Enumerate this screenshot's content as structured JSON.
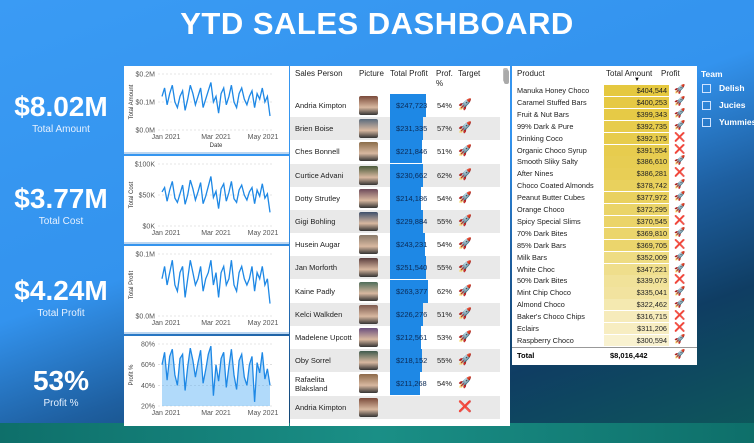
{
  "title": "YTD SALES DASHBOARD",
  "kpis": [
    {
      "value": "$8.02M",
      "label": "Total Amount"
    },
    {
      "value": "$3.77M",
      "label": "Total Cost"
    },
    {
      "value": "$4.24M",
      "label": "Total Profit"
    },
    {
      "value": "53%",
      "label": "Profit %"
    }
  ],
  "colors": {
    "accent": "#1e88e5",
    "line": "#1e88e5",
    "header_bg": "#3a9bf4",
    "gold": "#e2c22a",
    "light_gold": "#f7efb8"
  },
  "chart_data": [
    {
      "type": "line",
      "ylabel": "Total Amount",
      "xlabel": "Date",
      "ticks_y": [
        "$0.2M",
        "$0.1M",
        "$0.0M"
      ],
      "ticks_x": [
        "Jan 2021",
        "Mar 2021",
        "May 2021"
      ],
      "ylim": [
        0,
        0.2
      ],
      "values": [
        0.12,
        0.15,
        0.09,
        0.13,
        0.16,
        0.1,
        0.08,
        0.12,
        0.14,
        0.07,
        0.11,
        0.16,
        0.13,
        0.09,
        0.12,
        0.15,
        0.08,
        0.11,
        0.14,
        0.17,
        0.1,
        0.12,
        0.06,
        0.13,
        0.15,
        0.09,
        0.12,
        0.16,
        0.1,
        0.08,
        0.13,
        0.15,
        0.11,
        0.09,
        0.12,
        0.14,
        0.08,
        0.13,
        0.11,
        0.15,
        0.1,
        0.12,
        0.05
      ]
    },
    {
      "type": "line",
      "ylabel": "Total Cost",
      "ticks_y": [
        "$100K",
        "$50K",
        "$0K"
      ],
      "ticks_x": [
        "Jan 2021",
        "Mar 2021",
        "May 2021"
      ],
      "ylim": [
        0,
        100
      ],
      "values": [
        55,
        62,
        40,
        58,
        72,
        45,
        38,
        52,
        66,
        35,
        50,
        74,
        60,
        42,
        55,
        70,
        36,
        48,
        64,
        80,
        46,
        56,
        28,
        60,
        68,
        40,
        54,
        72,
        44,
        38,
        58,
        66,
        50,
        42,
        55,
        62,
        36,
        58,
        48,
        68,
        45,
        52,
        22
      ]
    },
    {
      "type": "line",
      "ylabel": "Total Profit",
      "ticks_y": [
        "$0.1M",
        "$0.0M"
      ],
      "ticks_x": [
        "Jan 2021",
        "Mar 2021",
        "May 2021"
      ],
      "ylim": [
        0,
        0.1
      ],
      "values": [
        0.06,
        0.08,
        0.05,
        0.07,
        0.09,
        0.05,
        0.04,
        0.07,
        0.08,
        0.03,
        0.06,
        0.09,
        0.07,
        0.05,
        0.06,
        0.08,
        0.04,
        0.06,
        0.07,
        0.09,
        0.05,
        0.07,
        0.03,
        0.07,
        0.08,
        0.05,
        0.06,
        0.09,
        0.05,
        0.04,
        0.07,
        0.08,
        0.06,
        0.05,
        0.06,
        0.08,
        0.04,
        0.07,
        0.06,
        0.08,
        0.05,
        0.06,
        0.02
      ]
    },
    {
      "type": "area",
      "ylabel": "Profit %",
      "ticks_y": [
        "80%",
        "60%",
        "40%",
        "20%"
      ],
      "ticks_x": [
        "Jan 2021",
        "Mar 2021",
        "May 2021"
      ],
      "ylim": [
        20,
        80
      ],
      "values": [
        60,
        72,
        45,
        68,
        75,
        50,
        40,
        66,
        70,
        35,
        58,
        76,
        64,
        48,
        62,
        74,
        42,
        55,
        70,
        78,
        30,
        60,
        44,
        66,
        72,
        38,
        58,
        75,
        50,
        36,
        64,
        70,
        48,
        40,
        60,
        68,
        24,
        62,
        52,
        72,
        46,
        56,
        40
      ]
    }
  ],
  "sales_table": {
    "headers": {
      "person": "Sales Person",
      "picture": "Picture",
      "profit": "Total Profit",
      "pct": "Prof. %",
      "target": "Target"
    },
    "rows": [
      {
        "name": "Andria Kimpton",
        "profit": "$247,723",
        "pct": "54%",
        "target": "rocket",
        "fill": 0.94
      },
      {
        "name": "Brien Boise",
        "profit": "$231,335",
        "pct": "57%",
        "target": "rocket",
        "fill": 0.88
      },
      {
        "name": "Ches Bonnell",
        "profit": "$221,846",
        "pct": "51%",
        "target": "rocket",
        "fill": 0.84
      },
      {
        "name": "Curtice Advani",
        "profit": "$230,662",
        "pct": "62%",
        "target": "rocket",
        "fill": 0.87
      },
      {
        "name": "Dotty Strutley",
        "profit": "$214,186",
        "pct": "54%",
        "target": "rocket",
        "fill": 0.81
      },
      {
        "name": "Gigi Bohling",
        "profit": "$229,884",
        "pct": "55%",
        "target": "rocket",
        "fill": 0.87
      },
      {
        "name": "Husein Augar",
        "profit": "$243,231",
        "pct": "54%",
        "target": "rocket",
        "fill": 0.92
      },
      {
        "name": "Jan Morforth",
        "profit": "$251,540",
        "pct": "55%",
        "target": "rocket",
        "fill": 0.95
      },
      {
        "name": "Kaine Padly",
        "profit": "$263,377",
        "pct": "62%",
        "target": "rocket",
        "fill": 1.0
      },
      {
        "name": "Kelci Walkden",
        "profit": "$226,276",
        "pct": "51%",
        "target": "rocket",
        "fill": 0.86
      },
      {
        "name": "Madelene Upcott",
        "profit": "$212,561",
        "pct": "53%",
        "target": "rocket",
        "fill": 0.81
      },
      {
        "name": "Oby Sorrel",
        "profit": "$218,152",
        "pct": "55%",
        "target": "rocket",
        "fill": 0.83
      },
      {
        "name": "Rafaelita Blaksland",
        "profit": "$211,268",
        "pct": "54%",
        "target": "rocket",
        "fill": 0.8
      },
      {
        "name": "Andria Kimpton",
        "profit": "",
        "pct": "",
        "target": "cross",
        "fill": 0.0
      }
    ]
  },
  "product_table": {
    "headers": {
      "product": "Product",
      "amount": "Total Amount",
      "profit": "Profit"
    },
    "rows": [
      {
        "name": "Manuka Honey Choco",
        "amount": "$404,544",
        "icon": "rocket",
        "fill": 1.0
      },
      {
        "name": "Caramel Stuffed Bars",
        "amount": "$400,253",
        "icon": "rocket",
        "fill": 0.97
      },
      {
        "name": "Fruit & Nut Bars",
        "amount": "$399,343",
        "icon": "rocket",
        "fill": 0.96
      },
      {
        "name": "99% Dark & Pure",
        "amount": "$392,735",
        "icon": "rocket",
        "fill": 0.92
      },
      {
        "name": "Drinking Coco",
        "amount": "$392,175",
        "icon": "cross",
        "fill": 0.91
      },
      {
        "name": "Organic Choco Syrup",
        "amount": "$391,554",
        "icon": "cross",
        "fill": 0.9
      },
      {
        "name": "Smooth Sliky Salty",
        "amount": "$386,610",
        "icon": "rocket",
        "fill": 0.87
      },
      {
        "name": "After Nines",
        "amount": "$386,281",
        "icon": "cross",
        "fill": 0.86
      },
      {
        "name": "Choco Coated Almonds",
        "amount": "$378,742",
        "icon": "rocket",
        "fill": 0.8
      },
      {
        "name": "Peanut Butter Cubes",
        "amount": "$377,972",
        "icon": "rocket",
        "fill": 0.79
      },
      {
        "name": "Orange Choco",
        "amount": "$372,295",
        "icon": "rocket",
        "fill": 0.74
      },
      {
        "name": "Spicy Special Slims",
        "amount": "$370,545",
        "icon": "cross",
        "fill": 0.72
      },
      {
        "name": "70% Dark Bites",
        "amount": "$369,810",
        "icon": "rocket",
        "fill": 0.71
      },
      {
        "name": "85% Dark Bars",
        "amount": "$369,705",
        "icon": "cross",
        "fill": 0.71
      },
      {
        "name": "Milk Bars",
        "amount": "$352,009",
        "icon": "rocket",
        "fill": 0.55
      },
      {
        "name": "White Choc",
        "amount": "$347,221",
        "icon": "rocket",
        "fill": 0.5
      },
      {
        "name": "50% Dark Bites",
        "amount": "$339,073",
        "icon": "cross",
        "fill": 0.42
      },
      {
        "name": "Mint Chip Choco",
        "amount": "$335,041",
        "icon": "rocket",
        "fill": 0.38
      },
      {
        "name": "Almond Choco",
        "amount": "$322,462",
        "icon": "rocket",
        "fill": 0.26
      },
      {
        "name": "Baker's Choco Chips",
        "amount": "$316,715",
        "icon": "cross",
        "fill": 0.2
      },
      {
        "name": "Eclairs",
        "amount": "$311,206",
        "icon": "cross",
        "fill": 0.15
      },
      {
        "name": "Raspberry Choco",
        "amount": "$300,594",
        "icon": "rocket",
        "fill": 0.05
      }
    ],
    "total_label": "Total",
    "total_amount": "$8,016,442",
    "total_icon": "rocket"
  },
  "slicer": {
    "title": "Team",
    "items": [
      "Delish",
      "Jucies",
      "Yummies"
    ]
  }
}
